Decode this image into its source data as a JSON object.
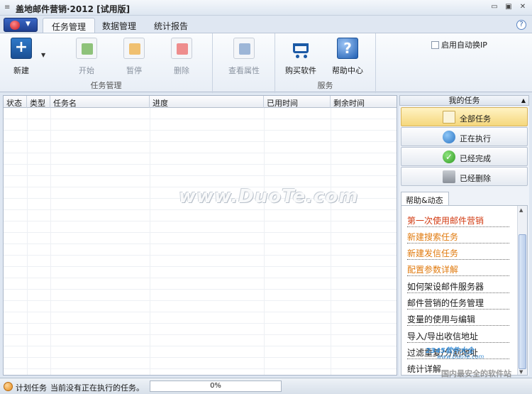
{
  "window": {
    "title": "盖地邮件营销·2012 [试用版]"
  },
  "ribbon_tabs": [
    {
      "label": "任务管理",
      "active": true
    },
    {
      "label": "数据管理",
      "active": false
    },
    {
      "label": "统计报告",
      "active": false
    }
  ],
  "ribbon": {
    "group_task": {
      "label": "任务管理",
      "new_label": "新建",
      "start_label": "开始",
      "pause_label": "暂停",
      "delete_label": "删除"
    },
    "group_props": {
      "view_props_label": "查看属性"
    },
    "group_service": {
      "label": "服务",
      "buy_label": "购买软件",
      "help_label": "帮助中心"
    },
    "auto_ip_label": "启用自动换IP"
  },
  "table": {
    "columns": [
      "状态",
      "类型",
      "任务名",
      "进度",
      "已用时间",
      "剩余时间"
    ],
    "rows": []
  },
  "my_tasks": {
    "header": "我的任务",
    "items": [
      {
        "label": "全部任务",
        "active": true
      },
      {
        "label": "正在执行",
        "active": false
      },
      {
        "label": "已经完成",
        "active": false
      },
      {
        "label": "已经删除",
        "active": false
      }
    ]
  },
  "help_news": {
    "tab_label": "帮助&动态",
    "items": [
      {
        "label": "第一次使用邮件营销",
        "color": "red"
      },
      {
        "label": "新建搜索任务",
        "color": "orange"
      },
      {
        "label": "新建发信任务",
        "color": "orange"
      },
      {
        "label": "配置参数详解",
        "color": "orange"
      },
      {
        "label": "如何架设邮件服务器",
        "color": "normal"
      },
      {
        "label": "邮件营销的任务管理",
        "color": "normal"
      },
      {
        "label": "变量的使用与编辑",
        "color": "normal"
      },
      {
        "label": "导入/导出收信地址",
        "color": "normal"
      },
      {
        "label": "过滤重复/分割地址",
        "color": "normal"
      },
      {
        "label": "统计详解",
        "color": "normal"
      }
    ]
  },
  "watermark": {
    "main": "www.DuoTe.com",
    "site": "2345软件大全",
    "site_url": "www.DuoTe.com",
    "slogan": "国内最安全的软件站"
  },
  "status": {
    "label": "计划任务",
    "message": "当前没有正在执行的任务。",
    "progress_percent": 0,
    "progress_text": "0%"
  },
  "colors": {
    "accent": "#1f3f8f",
    "link_red": "#d23b12",
    "link_orange": "#e07a0e"
  }
}
